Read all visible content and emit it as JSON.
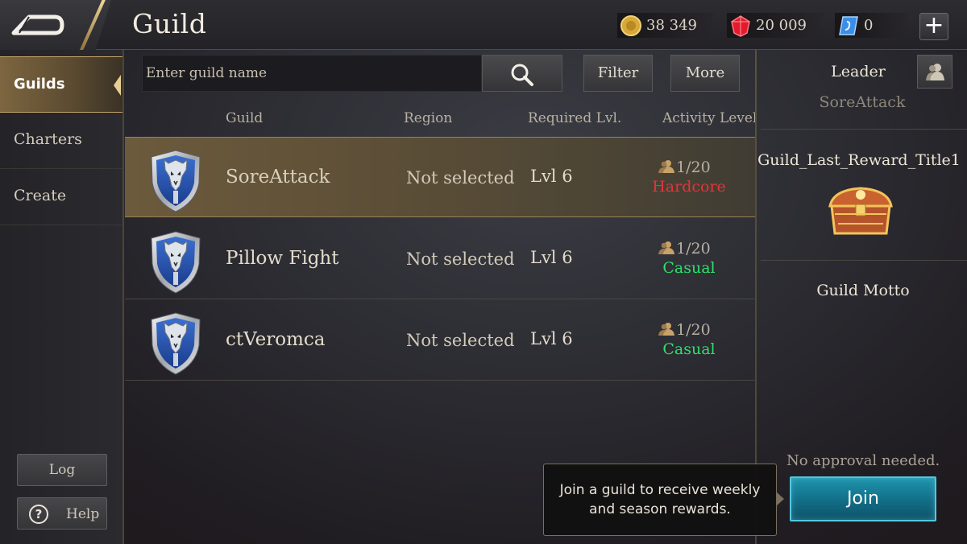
{
  "header": {
    "title": "Guild",
    "currencies": [
      {
        "icon": "gold-coin-icon",
        "value": "38 349"
      },
      {
        "icon": "red-gem-icon",
        "value": "20 009"
      },
      {
        "icon": "blue-voucher-icon",
        "value": "0"
      }
    ],
    "plus_label": "+"
  },
  "sidebar": {
    "items": [
      {
        "label": "Guilds",
        "active": true
      },
      {
        "label": "Charters",
        "active": false
      },
      {
        "label": "Create",
        "active": false
      }
    ],
    "log_label": "Log",
    "help_label": "Help",
    "help_icon_glyph": "?"
  },
  "search": {
    "placeholder": "Enter guild name",
    "value": "",
    "filter_label": "Filter",
    "more_label": "More"
  },
  "table": {
    "headers": [
      "Guild",
      "Region",
      "Required Lvl.",
      "Activity Level"
    ],
    "rows": [
      {
        "name": "SoreAttack",
        "region": "Not selected",
        "level": "Lvl 6",
        "members": "1/20",
        "activity": "Hardcore",
        "selected": true
      },
      {
        "name": "Pillow Fight",
        "region": "Not selected",
        "level": "Lvl 6",
        "members": "1/20",
        "activity": "Casual",
        "selected": false
      },
      {
        "name": "ctVeromca",
        "region": "Not selected",
        "level": "Lvl 6",
        "members": "1/20",
        "activity": "Casual",
        "selected": false
      }
    ]
  },
  "colors": {
    "hardcore": "#e2353a",
    "casual": "#2fe06a",
    "gold_accent": "#c7a66b",
    "join_button": "#126d86"
  },
  "details": {
    "leader_label": "Leader",
    "leader_name": "SoreAttack",
    "reward_title": "Guild_Last_Reward_Title1",
    "motto_label": "Guild Motto",
    "approval_text": "No approval needed.",
    "join_label": "Join",
    "tooltip_line1": "Join a guild to receive weekly",
    "tooltip_line2": "and season rewards."
  }
}
